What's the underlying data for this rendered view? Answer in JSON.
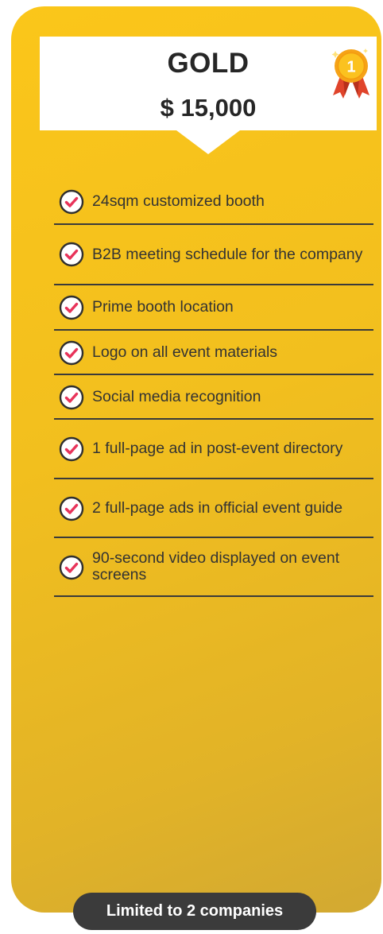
{
  "plan": {
    "name": "GOLD",
    "price": "$ 15,000",
    "medal_number": "1",
    "medal_icon": "gold-medal-icon",
    "colors": {
      "card_top": "#fbc61a",
      "card_bottom": "#d2a932",
      "text_dark": "#262626",
      "check_accent": "#e8335a",
      "pill_bg": "#3b3b3b"
    }
  },
  "features": [
    {
      "icon": "check-circle-icon",
      "label": "24sqm customized booth"
    },
    {
      "icon": "check-circle-icon",
      "label": "B2B meeting schedule for the company"
    },
    {
      "icon": "check-circle-icon",
      "label": "Prime booth location"
    },
    {
      "icon": "check-circle-icon",
      "label": "Logo on all event materials"
    },
    {
      "icon": "check-circle-icon",
      "label": "Social media recognition"
    },
    {
      "icon": "check-circle-icon",
      "label": "1 full-page ad in post-event directory"
    },
    {
      "icon": "check-circle-icon",
      "label": "2 full-page ads in official event guide"
    },
    {
      "icon": "check-circle-icon",
      "label": "90-second video displayed on event screens"
    }
  ],
  "footer": {
    "limit_label": "Limited to 2 companies"
  }
}
